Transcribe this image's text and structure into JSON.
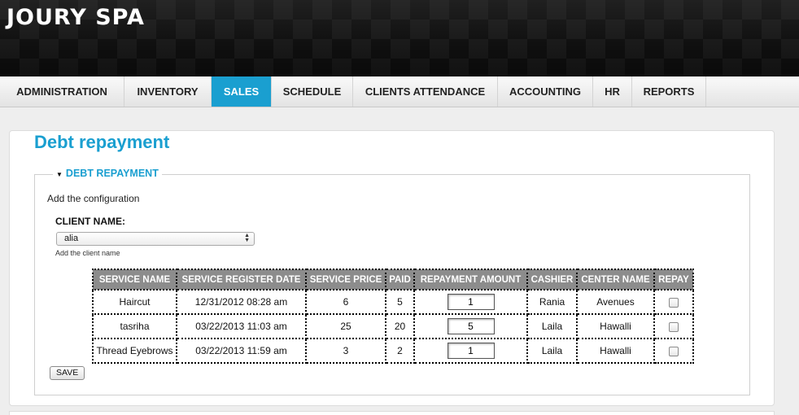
{
  "app": {
    "title": "JOURY SPA"
  },
  "nav": {
    "items": [
      {
        "label": "ADMINISTRATION",
        "active": false
      },
      {
        "label": "INVENTORY",
        "active": false
      },
      {
        "label": "SALES",
        "active": true
      },
      {
        "label": "SCHEDULE",
        "active": false
      },
      {
        "label": "CLIENTS ATTENDANCE",
        "active": false
      },
      {
        "label": "ACCOUNTING",
        "active": false
      },
      {
        "label": "HR",
        "active": false
      },
      {
        "label": "REPORTS",
        "active": false
      }
    ]
  },
  "page": {
    "title": "Debt repayment",
    "section_title": "DEBT REPAYMENT",
    "description": "Add the configuration",
    "client_label": "CLIENT NAME:",
    "client_value": "alia",
    "client_hint": "Add the client name",
    "save_label": "SAVE"
  },
  "table": {
    "headers": [
      "SERVICE NAME",
      "SERVICE REGISTER DATE",
      "SERVICE PRICE",
      "PAID",
      "REPAYMENT AMOUNT",
      "CASHIER",
      "CENTER NAME",
      "REPAY"
    ],
    "rows": [
      {
        "service": "Haircut",
        "date": "12/31/2012 08:28 am",
        "price": "6",
        "paid": "5",
        "amount": "1",
        "cashier": "Rania",
        "center": "Avenues"
      },
      {
        "service": "tasriha",
        "date": "03/22/2013 11:03 am",
        "price": "25",
        "paid": "20",
        "amount": "5",
        "cashier": "Laila",
        "center": "Hawalli"
      },
      {
        "service": "Thread Eyebrows",
        "date": "03/22/2013 11:59 am",
        "price": "3",
        "paid": "2",
        "amount": "1",
        "cashier": "Laila",
        "center": "Hawalli"
      }
    ]
  },
  "colors": {
    "accent": "#1a9fd0",
    "header_bg": "#1c1c1c",
    "table_header": "#8c8c8c"
  }
}
